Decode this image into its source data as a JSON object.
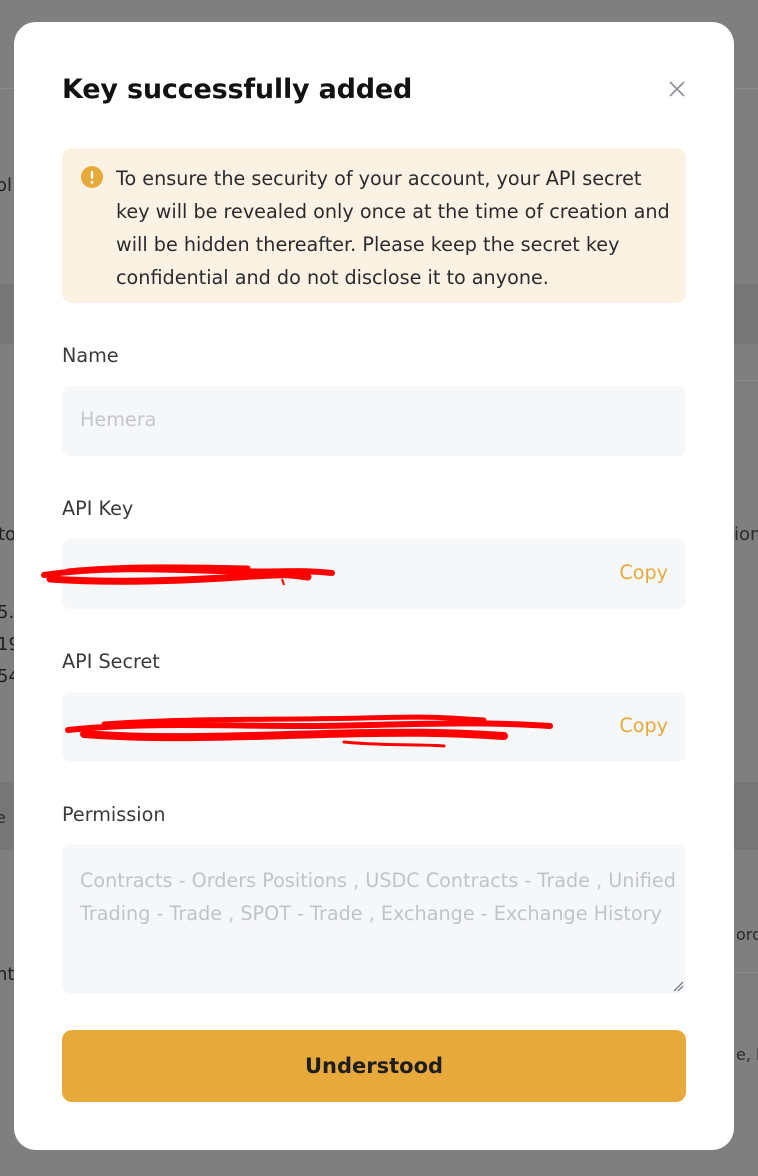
{
  "background": {
    "fragments": [
      "ol",
      "to",
      "5.",
      "19",
      "54",
      "e",
      "ntr",
      "ion",
      "orde",
      "e, le"
    ]
  },
  "modal": {
    "title": "Key successfully added",
    "notice": "To ensure the security of your account, your API secret key will be revealed only once at the time of creation and will be hidden thereafter. Please keep the secret key confidential and do not disclose it to anyone.",
    "name_label": "Name",
    "name_placeholder": "Hemera",
    "api_key_label": "API Key",
    "api_key_copy": "Copy",
    "api_secret_label": "API Secret",
    "api_secret_copy": "Copy",
    "permission_label": "Permission",
    "permission_value": "Contracts - Orders Positions  , USDC Contracts - Trade  , Unified Trading - Trade  , SPOT - Trade  , Exchange - Exchange History",
    "button_label": "Understood"
  },
  "colors": {
    "accent": "#e7a93a",
    "notice_bg": "#fcf2e3",
    "redaction": "#ff0000"
  }
}
